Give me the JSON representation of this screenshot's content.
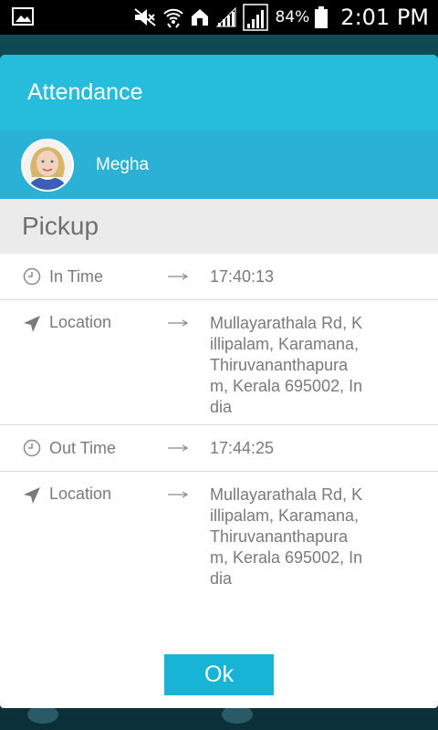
{
  "status_bar": {
    "battery_percent": "84%",
    "time": "2:01 PM",
    "icons": [
      "image-icon",
      "mute-icon",
      "wifi-icon",
      "home-icon",
      "signal-icon",
      "signal-icon",
      "battery-icon"
    ]
  },
  "dialog": {
    "title": "Attendance",
    "student": {
      "name": "Megha",
      "avatar": "avatar"
    },
    "section_title": "Pickup",
    "rows": [
      {
        "icon": "clock-icon",
        "label": "In Time",
        "value": "17:40:13"
      },
      {
        "icon": "location-arrow-icon",
        "label": "Location",
        "value": "Mullayarathala Rd, Killipalam, Karamana, Thiruvananthapuram, Kerala 695002, India"
      },
      {
        "icon": "clock-icon",
        "label": "Out Time",
        "value": "17:44:25"
      },
      {
        "icon": "location-arrow-icon",
        "label": "Location",
        "value": "Mullayarathala Rd, Killipalam, Karamana, Thiruvananthapuram, Kerala 695002, India"
      }
    ],
    "ok_label": "Ok"
  },
  "colors": {
    "header": "#26bcdc",
    "profile_bar": "#2bb0d6",
    "button": "#18b4d6",
    "section_bg": "#ebebeb"
  }
}
